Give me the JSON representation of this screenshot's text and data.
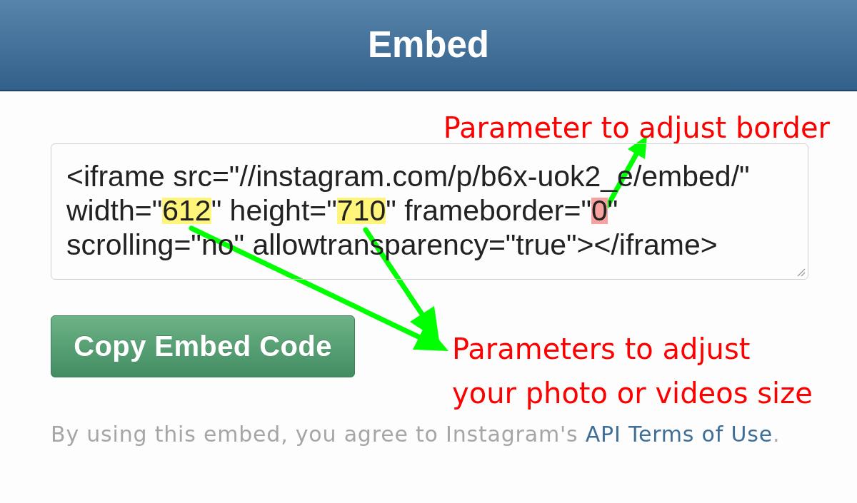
{
  "header": {
    "title": "Embed"
  },
  "border_note": {
    "text": "Parameter to adjust border"
  },
  "embed_code": {
    "lines": [
      {
        "segments": [
          {
            "kind": "text",
            "text": "<iframe src=\"//instagram.com/p/b6x-uok2_e/embed/\""
          }
        ]
      },
      {
        "segments": [
          {
            "kind": "text",
            "text": "width=\""
          },
          {
            "kind": "marked",
            "text": "612",
            "color": "#fff57a"
          },
          {
            "kind": "text",
            "text": "\" height=\""
          },
          {
            "kind": "marked",
            "text": "710",
            "color": "#fff57a"
          },
          {
            "kind": "text",
            "text": "\" frameborder=\""
          },
          {
            "kind": "marked",
            "text": "0",
            "color": "#f7a1a1"
          },
          {
            "kind": "text",
            "text": "\""
          }
        ]
      },
      {
        "segments": [
          {
            "kind": "text",
            "text": "scrolling=\"no\" allowtransparency=\"true\"></iframe>"
          }
        ]
      }
    ]
  },
  "copy_button": {
    "label": "Copy Embed Code"
  },
  "size_note": {
    "lines": [
      "Parameters to adjust",
      "your photo or videos size"
    ]
  },
  "terms": {
    "before": "By using this embed, you agree to Instagram's",
    "link": "API Terms of Use",
    "after": "."
  }
}
